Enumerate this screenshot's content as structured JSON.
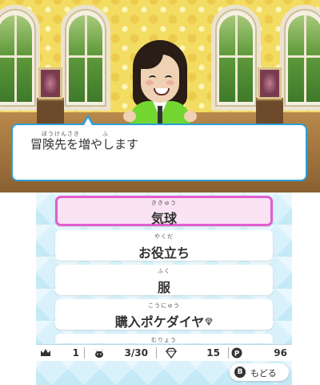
{
  "top_screen": {
    "speech": {
      "ruby": [
        "ぼうけんさき",
        "ふ"
      ],
      "text": "冒険先を増やします"
    }
  },
  "menu": {
    "items": [
      {
        "ruby": "ききゅう",
        "label": "気球",
        "selected": true
      },
      {
        "ruby": "やくだ",
        "label": "お役立ち",
        "selected": false
      },
      {
        "ruby": "ふく",
        "label": "服",
        "selected": false
      },
      {
        "ruby": "こうにゅう",
        "label": "購入ポケダイヤ",
        "gem": true,
        "selected": false
      },
      {
        "ruby": "むりょう",
        "label": "",
        "selected": false
      }
    ]
  },
  "status_bar": {
    "crown_icon": "crown-icon",
    "crown_count": "1",
    "pokemon_icon": "pikachu-icon",
    "pokemon_count": "3/30",
    "gem_icon": "diamond-icon",
    "gem_count": "15",
    "coin_icon": "p-coin-icon",
    "coin_count": "96"
  },
  "back_button": {
    "icon": "B",
    "label": "もどる"
  },
  "colors": {
    "selection_border": "#e15fd0",
    "selection_bg": "#fae3f2",
    "bubble_border": "#2a9fd8",
    "mii_shirt": "#74d631"
  }
}
